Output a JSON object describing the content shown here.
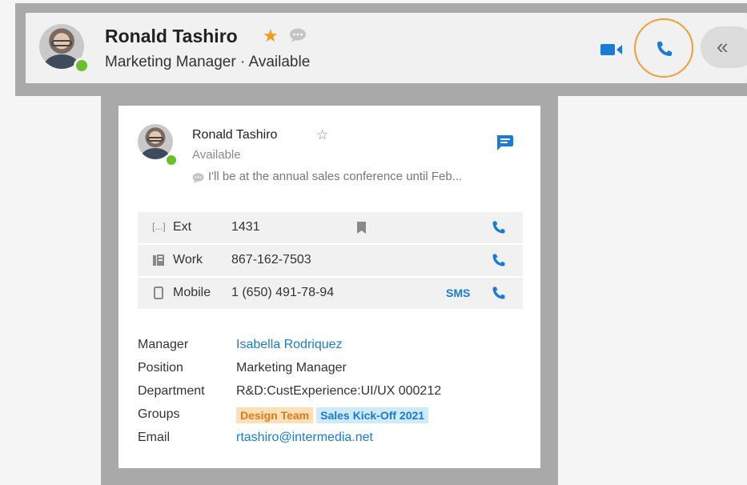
{
  "header": {
    "name": "Ronald Tashiro",
    "subtitle": "Marketing Manager · Available",
    "collapse_glyph": "«",
    "icons": [
      "star-icon",
      "chat-bubble-icon",
      "video-icon",
      "phone-icon",
      "collapse-icon"
    ],
    "accent": "#1a7ad8",
    "star_color": "#f39a1c",
    "status_color": "#6bbf2b",
    "highlight_ring": "#f0a030"
  },
  "card": {
    "name": "Ronald Tashiro",
    "availability": "Available",
    "status_message": "I'll be at the annual sales conference until Feb...",
    "phones": [
      {
        "label": "Ext",
        "value": "1431",
        "icon": "ext-icon",
        "bookmark": true,
        "sms": ""
      },
      {
        "label": "Work",
        "value": "867-162-7503",
        "icon": "building-icon",
        "bookmark": false,
        "sms": ""
      },
      {
        "label": "Mobile",
        "value": "1 (650) 491-78-94",
        "icon": "mobile-icon",
        "bookmark": false,
        "sms": "SMS"
      }
    ],
    "details": {
      "manager_label": "Manager",
      "manager": "Isabella Rodriquez",
      "position_label": "Position",
      "position": "Marketing Manager",
      "department_label": "Department",
      "department": "R&D:CustExperience:UI/UX 000212",
      "groups_label": "Groups",
      "groups": [
        "Design Team",
        "Sales Kick-Off 2021"
      ],
      "email_label": "Email",
      "email": "rtashiro@intermedia.net"
    }
  }
}
